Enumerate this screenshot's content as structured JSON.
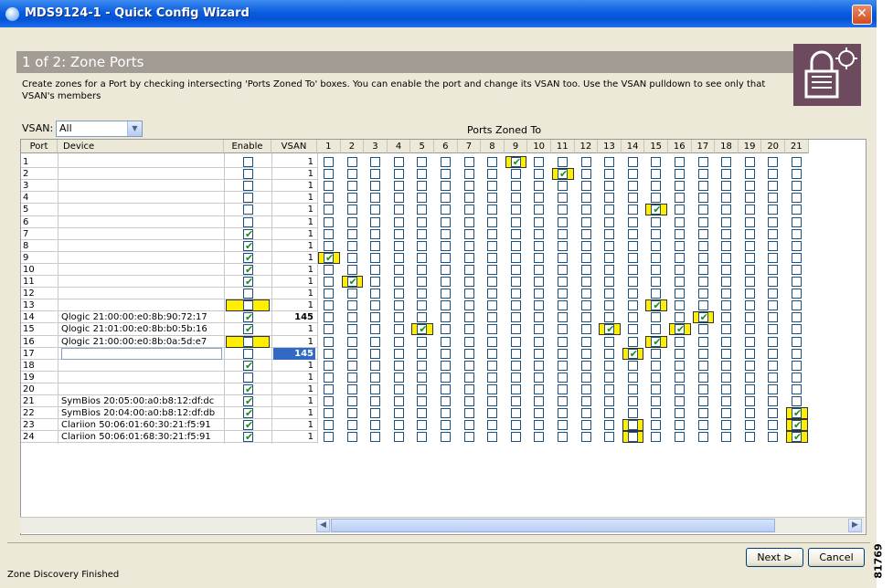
{
  "window": {
    "title": "MDS9124-1 - Quick Config Wizard",
    "close_glyph": "✕"
  },
  "step": {
    "title": "1 of 2: Zone Ports",
    "description": "Create zones for a Port by checking intersecting 'Ports Zoned To' boxes. You can enable the port and change its VSAN too. Use the VSAN pulldown to see only that VSAN's members"
  },
  "filter": {
    "label": "VSAN:",
    "value": "All"
  },
  "table": {
    "zoned_to_label": "Ports Zoned To",
    "headers": {
      "port": "Port",
      "device": "Device",
      "enable": "Enable",
      "vsan": "VSAN"
    },
    "zone_columns": [
      "1",
      "2",
      "3",
      "4",
      "5",
      "6",
      "7",
      "8",
      "9",
      "10",
      "11",
      "12",
      "13",
      "14",
      "15",
      "16",
      "17",
      "18",
      "19",
      "20",
      "21"
    ],
    "rows": [
      {
        "port": "1",
        "device": "",
        "enable": false,
        "vsan": "1"
      },
      {
        "port": "2",
        "device": "",
        "enable": false,
        "vsan": "1"
      },
      {
        "port": "3",
        "device": "",
        "enable": false,
        "vsan": "1"
      },
      {
        "port": "4",
        "device": "",
        "enable": false,
        "vsan": "1"
      },
      {
        "port": "5",
        "device": "",
        "enable": false,
        "vsan": "1"
      },
      {
        "port": "6",
        "device": "",
        "enable": false,
        "vsan": "1"
      },
      {
        "port": "7",
        "device": "",
        "enable": true,
        "vsan": "1"
      },
      {
        "port": "8",
        "device": "",
        "enable": true,
        "vsan": "1"
      },
      {
        "port": "9",
        "device": "",
        "enable": true,
        "vsan": "1"
      },
      {
        "port": "10",
        "device": "",
        "enable": true,
        "vsan": "1"
      },
      {
        "port": "11",
        "device": "",
        "enable": true,
        "vsan": "1"
      },
      {
        "port": "12",
        "device": "",
        "enable": false,
        "vsan": "1"
      },
      {
        "port": "13",
        "device": "",
        "enable": false,
        "vsan": "1"
      },
      {
        "port": "14",
        "device": "Qlogic 21:00:00:e0:8b:90:72:17",
        "enable": true,
        "vsan": "145"
      },
      {
        "port": "15",
        "device": "Qlogic 21:01:00:e0:8b:b0:5b:16",
        "enable": true,
        "vsan": "1"
      },
      {
        "port": "16",
        "device": "Qlogic 21:00:00:e0:8b:0a:5d:e7",
        "enable": false,
        "vsan": "1"
      },
      {
        "port": "17",
        "device": "",
        "enable": false,
        "vsan": "145"
      },
      {
        "port": "18",
        "device": "",
        "enable": true,
        "vsan": "1"
      },
      {
        "port": "19",
        "device": "",
        "enable": false,
        "vsan": "1"
      },
      {
        "port": "20",
        "device": "",
        "enable": true,
        "vsan": "1"
      },
      {
        "port": "21",
        "device": "SymBios 20:05:00:a0:b8:12:df:dc",
        "enable": true,
        "vsan": "1"
      },
      {
        "port": "22",
        "device": "SymBios 20:04:00:a0:b8:12:df:db",
        "enable": true,
        "vsan": "1"
      },
      {
        "port": "23",
        "device": "Clariion 50:06:01:60:30:21:f5:91",
        "enable": true,
        "vsan": "1"
      },
      {
        "port": "24",
        "device": "Clariion 50:06:01:68:30:21:f5:91",
        "enable": true,
        "vsan": "1"
      }
    ],
    "zone_checked": [
      [
        1,
        9
      ],
      [
        2,
        11
      ],
      [
        5,
        15
      ],
      [
        9,
        1
      ],
      [
        11,
        2
      ],
      [
        13,
        15
      ],
      [
        14,
        17
      ],
      [
        15,
        5
      ],
      [
        15,
        13
      ],
      [
        15,
        16
      ],
      [
        16,
        15
      ],
      [
        17,
        14
      ],
      [
        22,
        21
      ],
      [
        23,
        21
      ],
      [
        24,
        21
      ]
    ],
    "enable_highlighted_rows": [
      13,
      16
    ],
    "highlight_color": "#ffee00"
  },
  "buttons": {
    "next": "Next",
    "next_icon": "⊳",
    "cancel": "Cancel"
  },
  "status": "Zone Discovery Finished",
  "side_id": "81769"
}
